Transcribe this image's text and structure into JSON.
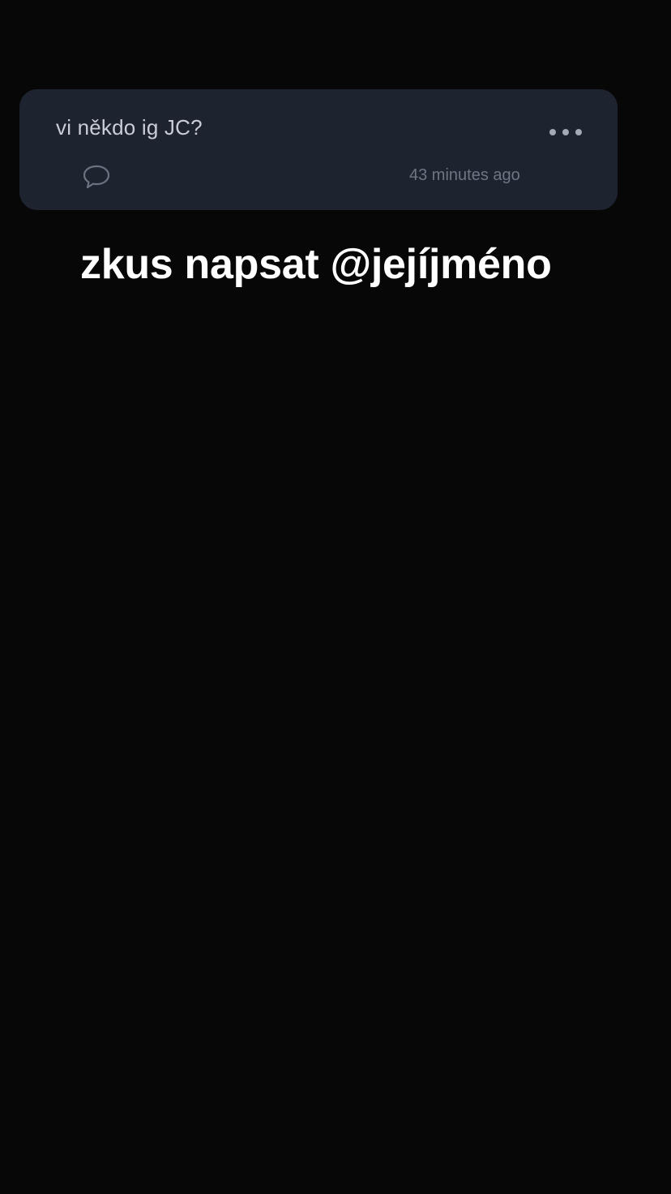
{
  "post": {
    "text": "vi někdo ig JC?",
    "timestamp": "43 minutes ago",
    "more_icon": "more-horizontal-icon",
    "comment_icon": "comment-bubble-icon"
  },
  "caption": {
    "text": "zkus napsat @jejíjméno"
  },
  "colors": {
    "background": "#070707",
    "card": "#1d2430",
    "post_text": "#c9ced6",
    "muted": "#6e7683",
    "caption": "#ffffff"
  }
}
